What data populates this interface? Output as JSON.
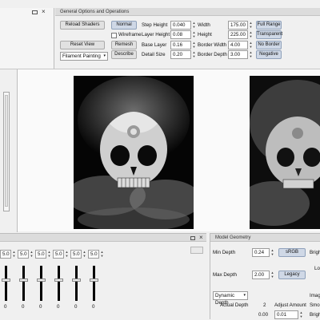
{
  "top_left_panel": {
    "icons": [
      "dock-icon",
      "close-icon"
    ]
  },
  "general_options": {
    "title": "General Options and Operations",
    "reload_shaders": "Reload Shaders",
    "reset_view": "Reset View",
    "painting_mode": "Filament Painting",
    "normal_label": "Normal",
    "wireframe_label": "Wireframe",
    "remesh_label": "Remesh",
    "describe_label": "Describe",
    "step_height": {
      "label": "Step Height",
      "value": "0.040"
    },
    "layer_height": {
      "label": "Layer Height",
      "value": "0.08"
    },
    "base_layer": {
      "label": "Base Layer",
      "value": "0.16"
    },
    "detail_size": {
      "label": "Detail Size",
      "value": "0.20"
    },
    "width": {
      "label": "Width",
      "value": "175.00"
    },
    "height": {
      "label": "Height",
      "value": "225.00"
    },
    "border_width": {
      "label": "Border Width",
      "value": "4.00"
    },
    "border_depth": {
      "label": "Border Depth",
      "value": "3.00"
    },
    "full_range": "Full Range",
    "transparent": "Transparent",
    "no_border": "No Border",
    "negative": "Negative"
  },
  "sliders_panel": {
    "values": [
      "5.0",
      "5.0",
      "5.0",
      "5.0",
      "5.0",
      "5.0"
    ],
    "levels": [
      0.6,
      0.6,
      0.6,
      0.6,
      0.6,
      0.6
    ],
    "bottom_values": [
      "0",
      "0",
      "0",
      "0",
      "0",
      "0"
    ]
  },
  "model_geometry": {
    "title": "Model Geometry",
    "min_depth": {
      "label": "Min Depth",
      "value": "0.24"
    },
    "max_depth": {
      "label": "Max Depth",
      "value": "2.00"
    },
    "srgb": "sRGB",
    "legacy": "Legacy",
    "bright_label": "Brigh",
    "lo_label": "Lo",
    "depth_mode": "Dynamic Depth",
    "imag_label": "Imag",
    "actual_depth": {
      "label": "Actual Depth",
      "value": "2"
    },
    "adjust_amount": {
      "label": "Adjust Amount",
      "value": "0.01"
    },
    "actual_value": "0.00",
    "smoo_label": "Smoo",
    "brig2_label": "Brigh"
  }
}
